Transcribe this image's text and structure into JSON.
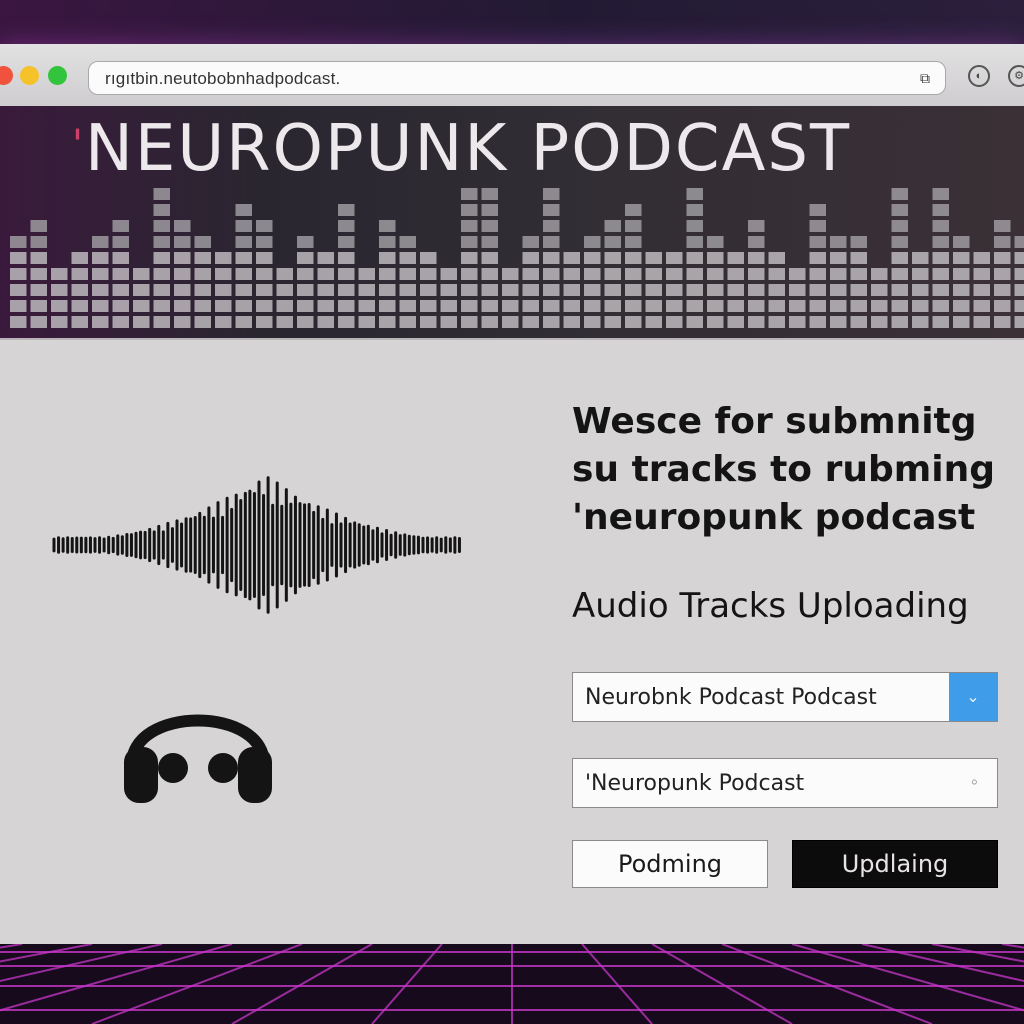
{
  "browser": {
    "url": "rıgıtbin.neutobobnhadpodcast."
  },
  "banner": {
    "prefix": "'",
    "title": "NEUROPUNK PODCAST"
  },
  "main": {
    "heading_lines": [
      "Wesce for submnitg",
      "su tracks to  rubming",
      "'neuropunk podcast"
    ],
    "section_title": "Audio Tracks  Uploading",
    "field1_value": "Neurobnk Podcast Podcast",
    "field2_value": "'Neuropunk Podcast",
    "button_left": "Podming",
    "button_right": "Updlaing"
  },
  "colors": {
    "accent": "#3f9ce8",
    "neon": "#c636c8"
  },
  "icons": {
    "waveform": "audio-waveform-icon",
    "headphones": "headphones-icon"
  }
}
